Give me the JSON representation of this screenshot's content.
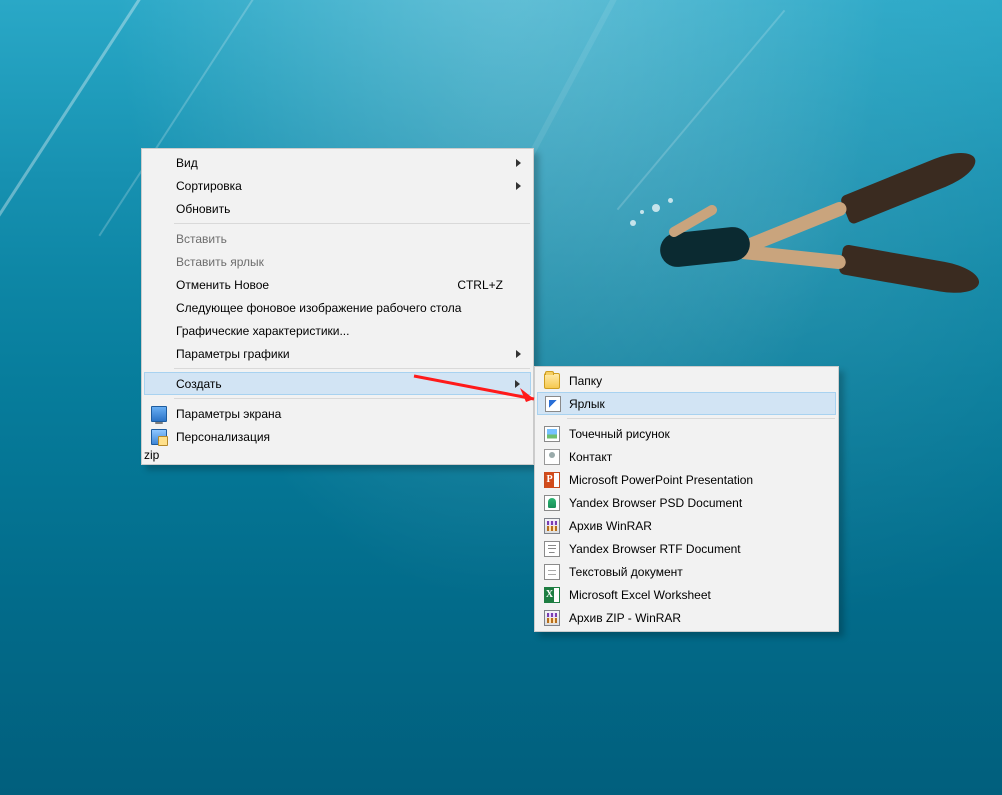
{
  "mainMenu": {
    "view": "Вид",
    "sort": "Сортировка",
    "refresh": "Обновить",
    "paste": "Вставить",
    "pasteShortcut": "Вставить ярлык",
    "undo": "Отменить Новое",
    "undo_shortcut": "CTRL+Z",
    "nextWallpaper": "Следующее фоновое изображение рабочего стола",
    "gfxChar": "Графические характеристики...",
    "gfxParams": "Параметры графики",
    "new": "Создать",
    "display": "Параметры экрана",
    "personal": "Персонализация"
  },
  "newSub": {
    "folder": "Папку",
    "shortcut": "Ярлык",
    "bmp": "Точечный рисунок",
    "contact": "Контакт",
    "ppt": "Microsoft PowerPoint Presentation",
    "psd": "Yandex Browser PSD Document",
    "rar": "Архив WinRAR",
    "rtf": "Yandex Browser RTF Document",
    "txt": "Текстовый документ",
    "xlsx": "Microsoft Excel Worksheet",
    "zip": "Архив ZIP - WinRAR"
  }
}
